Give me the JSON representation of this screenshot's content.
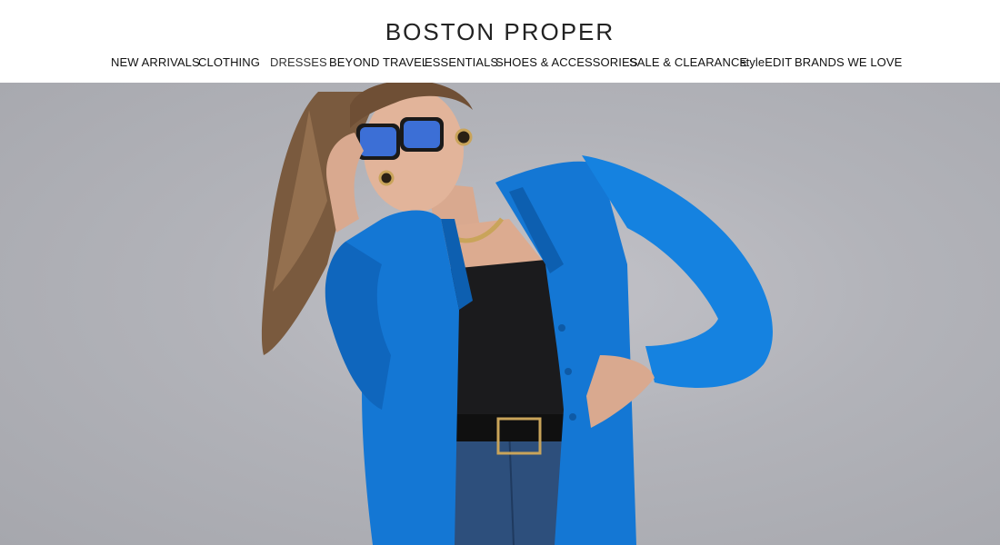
{
  "brand": {
    "logo_text": "BOSTON PROPER"
  },
  "nav": {
    "items": [
      {
        "label": "NEW ARRIVALS"
      },
      {
        "label": "CLOTHING"
      },
      {
        "label": "DRESSES"
      },
      {
        "label": "BEYOND TRAVEL"
      },
      {
        "label": "ESSENTIALS"
      },
      {
        "label": "SHOES & ACCESSORIES"
      },
      {
        "label": "SALE & CLEARANCE"
      },
      {
        "label": "styleEDIT"
      },
      {
        "label": "BRANDS WE LOVE"
      }
    ]
  },
  "hero": {
    "image_subject": "model-in-blue-blazer",
    "colors": {
      "background": "#b3b4ba",
      "blazer": "#1477d4",
      "top": "#1b1b1d",
      "jeans": "#2d4f7c"
    }
  }
}
